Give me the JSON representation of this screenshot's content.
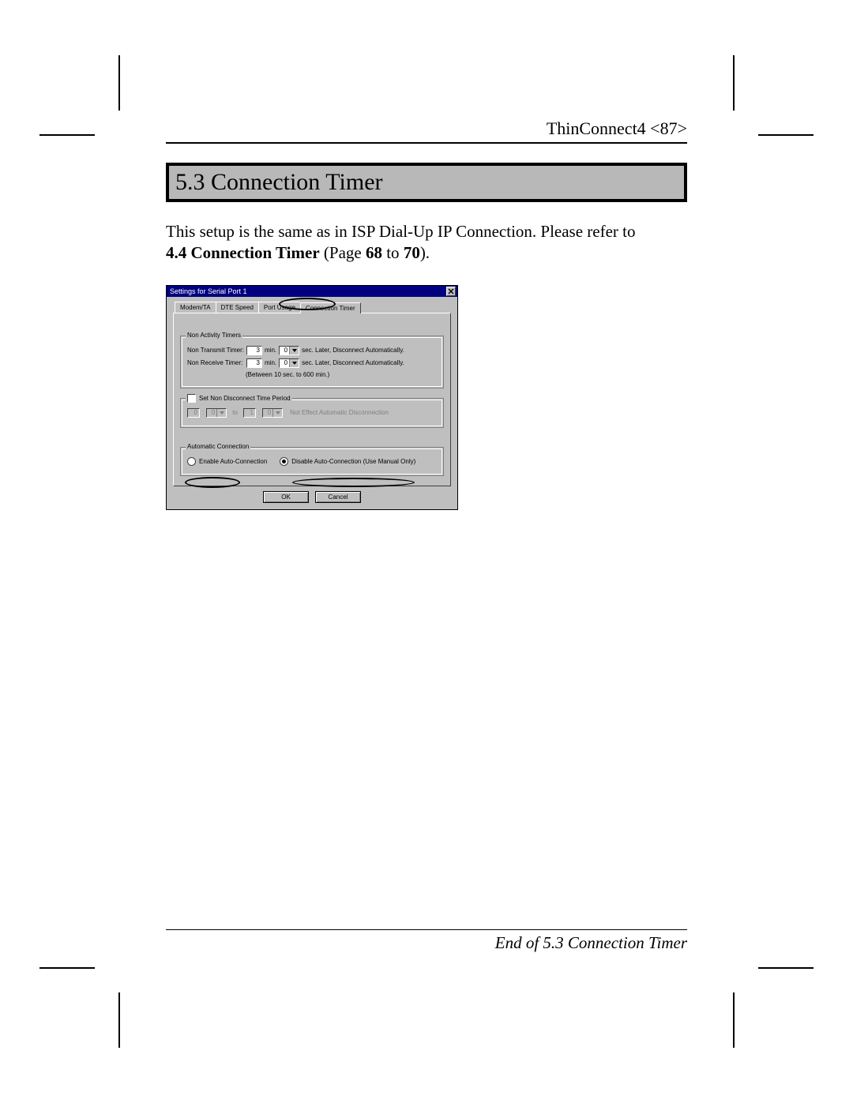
{
  "header": {
    "running_head": "ThinConnect4 <87>"
  },
  "section": {
    "number_title": "5.3 Connection Timer",
    "intro": "This setup is the same as in ISP Dial-Up IP Connection. Please refer to",
    "ref_strong": "4.4 Connection Timer",
    "ref_rest": " (Page ",
    "pg1": "68",
    "to": " to ",
    "pg2": "70",
    "close": ")."
  },
  "dialog": {
    "title": "Settings for Serial Port 1",
    "tabs": {
      "t1": "Modem/TA",
      "t2": "DTE Speed",
      "t3": "Port Usage",
      "t4": "Connection Timer"
    },
    "group_nonactivity": {
      "legend": "Non Activity Timers",
      "transmit_label": "Non Transmit Timer:",
      "receive_label": "Non Receive Timer:",
      "transmit_min": "3",
      "receive_min": "3",
      "sec_val": "0",
      "min_label": "min.",
      "after_text": "sec. Later, Disconnect Automatically.",
      "range_note": "(Between 10 sec. to 600 min.)"
    },
    "group_period": {
      "checkbox_label": "Set Non Disconnect Time Period",
      "from_h": "0",
      "from_m": "0",
      "to_label": "to",
      "to_h": "1",
      "to_m": "0",
      "note": "Not Effect Automatic Disconnection"
    },
    "group_auto": {
      "legend": "Automatic Connection",
      "enable_label": "Enable Auto-Connection",
      "disable_label": "Disable Auto-Connection (Use Manual Only)"
    },
    "buttons": {
      "ok": "OK",
      "cancel": "Cancel"
    }
  },
  "footer": {
    "end": "End of 5.3 Connection Timer"
  }
}
